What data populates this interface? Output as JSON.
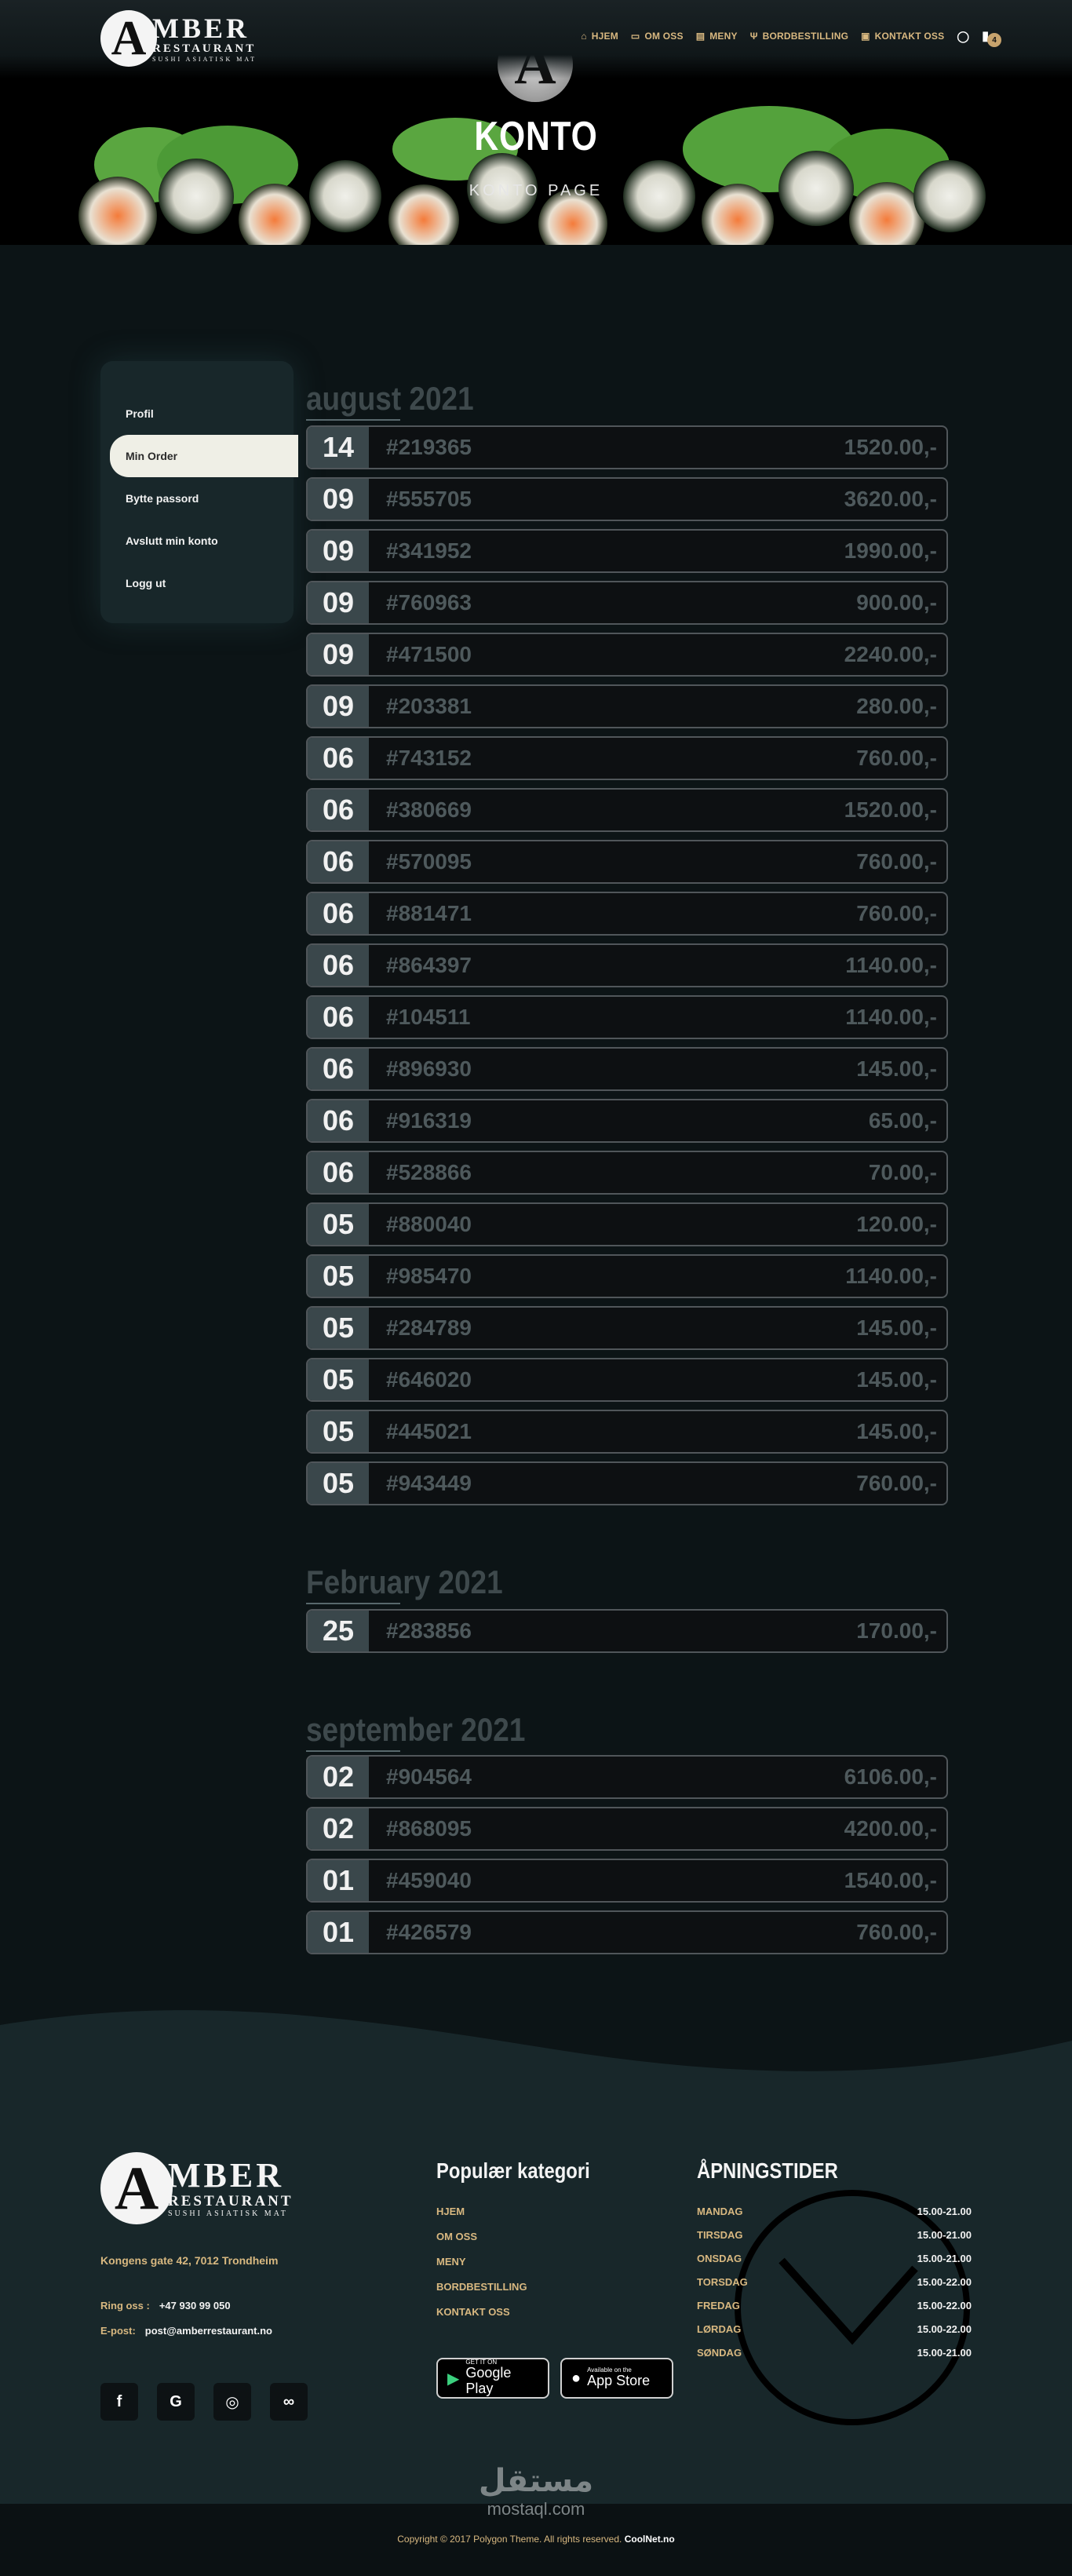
{
  "header": {
    "logo": {
      "letter": "A",
      "line1": "MBER",
      "line2": "RESTAURANT",
      "line3": "SUSHI ASIATISK MAT"
    },
    "nav": [
      {
        "label": "HJEM",
        "icon": "home-icon"
      },
      {
        "label": "OM OSS",
        "icon": "id-card-icon"
      },
      {
        "label": "MENY",
        "icon": "menu-book-icon"
      },
      {
        "label": "BORDBESTILLING",
        "icon": "cutlery-icon"
      },
      {
        "label": "KONTAKT OSS",
        "icon": "contact-icon"
      }
    ],
    "cart_count": "4"
  },
  "hero": {
    "badge_letter": "A",
    "title": "KONTO",
    "subtitle": "KONTO PAGE"
  },
  "sidebar": {
    "items": [
      {
        "label": "Profil"
      },
      {
        "label": "Min Order"
      },
      {
        "label": "Bytte passord"
      },
      {
        "label": "Avslutt min konto"
      },
      {
        "label": "Logg ut"
      }
    ],
    "active_index": 1
  },
  "orders": {
    "groups": [
      {
        "month": "august 2021",
        "rows": [
          {
            "day": "14",
            "id": "#219365",
            "amount": "1520.00,-"
          },
          {
            "day": "09",
            "id": "#555705",
            "amount": "3620.00,-"
          },
          {
            "day": "09",
            "id": "#341952",
            "amount": "1990.00,-"
          },
          {
            "day": "09",
            "id": "#760963",
            "amount": "900.00,-"
          },
          {
            "day": "09",
            "id": "#471500",
            "amount": "2240.00,-"
          },
          {
            "day": "09",
            "id": "#203381",
            "amount": "280.00,-"
          },
          {
            "day": "06",
            "id": "#743152",
            "amount": "760.00,-"
          },
          {
            "day": "06",
            "id": "#380669",
            "amount": "1520.00,-"
          },
          {
            "day": "06",
            "id": "#570095",
            "amount": "760.00,-"
          },
          {
            "day": "06",
            "id": "#881471",
            "amount": "760.00,-"
          },
          {
            "day": "06",
            "id": "#864397",
            "amount": "1140.00,-"
          },
          {
            "day": "06",
            "id": "#104511",
            "amount": "1140.00,-"
          },
          {
            "day": "06",
            "id": "#896930",
            "amount": "145.00,-"
          },
          {
            "day": "06",
            "id": "#916319",
            "amount": "65.00,-"
          },
          {
            "day": "06",
            "id": "#528866",
            "amount": "70.00,-"
          },
          {
            "day": "05",
            "id": "#880040",
            "amount": "120.00,-"
          },
          {
            "day": "05",
            "id": "#985470",
            "amount": "1140.00,-"
          },
          {
            "day": "05",
            "id": "#284789",
            "amount": "145.00,-"
          },
          {
            "day": "05",
            "id": "#646020",
            "amount": "145.00,-"
          },
          {
            "day": "05",
            "id": "#445021",
            "amount": "145.00,-"
          },
          {
            "day": "05",
            "id": "#943449",
            "amount": "760.00,-"
          }
        ]
      },
      {
        "month": "February 2021",
        "rows": [
          {
            "day": "25",
            "id": "#283856",
            "amount": "170.00,-"
          }
        ]
      },
      {
        "month": "september 2021",
        "rows": [
          {
            "day": "02",
            "id": "#904564",
            "amount": "6106.00,-"
          },
          {
            "day": "02",
            "id": "#868095",
            "amount": "4200.00,-"
          },
          {
            "day": "01",
            "id": "#459040",
            "amount": "1540.00,-"
          },
          {
            "day": "01",
            "id": "#426579",
            "amount": "760.00,-"
          }
        ]
      }
    ]
  },
  "footer": {
    "address": "Kongens gate 42, 7012 Trondheim",
    "phone_label": "Ring oss :",
    "phone": "+47 930 99 050",
    "email_label": "E-post:",
    "email": "post@amberrestaurant.no",
    "socials": [
      {
        "icon": "facebook-icon",
        "glyph": "f"
      },
      {
        "icon": "google-icon",
        "glyph": "G"
      },
      {
        "icon": "instagram-icon",
        "glyph": "◎"
      },
      {
        "icon": "tripadvisor-icon",
        "glyph": "∞"
      }
    ],
    "category_heading": "Populær kategori",
    "category_links": [
      "HJEM",
      "OM OSS",
      "MENY",
      "BORDBESTILLING",
      "KONTAKT OSS"
    ],
    "google_play": {
      "small": "GET IT ON",
      "big": "Google Play"
    },
    "app_store": {
      "small": "Available on the",
      "big": "App Store"
    },
    "hours_heading": "ÅPNINGSTIDER",
    "hours": [
      {
        "day": "MANDAG",
        "time": "15.00-21.00"
      },
      {
        "day": "TIRSDAG",
        "time": "15.00-21.00"
      },
      {
        "day": "ONSDAG",
        "time": "15.00-21.00"
      },
      {
        "day": "TORSDAG",
        "time": "15.00-22.00"
      },
      {
        "day": "FREDAG",
        "time": "15.00-22.00"
      },
      {
        "day": "LØRDAG",
        "time": "15.00-22.00"
      },
      {
        "day": "SØNDAG",
        "time": "15.00-21.00"
      }
    ],
    "watermark": "مستقل",
    "watermark_sub": "mostaql.com",
    "copyright_text": "Copyright © 2017 Polygon Theme. All rights reserved.",
    "copyright_brand": "CoolNet.no"
  },
  "colors": {
    "accent": "#d8b880",
    "background": "#0c1416",
    "panel": "#18272a"
  }
}
